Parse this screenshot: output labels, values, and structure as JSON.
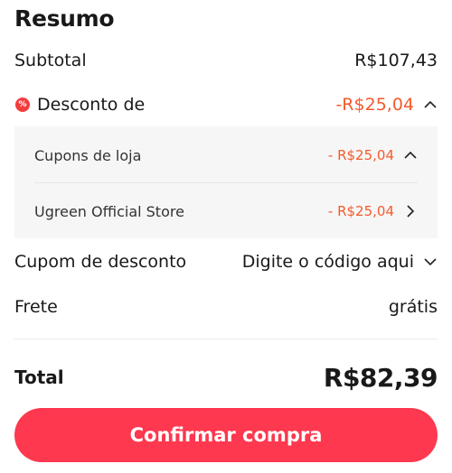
{
  "summary": {
    "title": "Resumo",
    "subtotal_label": "Subtotal",
    "subtotal_value": "R$107,43",
    "discount_label": "Desconto de",
    "discount_value": "-R$25,04",
    "discount_badge": "%",
    "store_coupons_label": "Cupons de loja",
    "store_coupons_value": "- R$25,04",
    "store_name": "Ugreen Official Store",
    "store_value": "- R$25,04",
    "coupon_label": "Cupom de desconto",
    "coupon_placeholder": "Digite o código aqui",
    "shipping_label": "Frete",
    "shipping_value": "grátis",
    "total_label": "Total",
    "total_value": "R$82,39",
    "confirm_label": "Confirmar compra"
  },
  "colors": {
    "accent": "#fd384f",
    "discount_red": "#f55a2c",
    "badge_red": "#f23d3d"
  },
  "icons": [
    "percent-badge-icon",
    "chevron-up-icon",
    "chevron-right-icon",
    "chevron-down-icon"
  ]
}
